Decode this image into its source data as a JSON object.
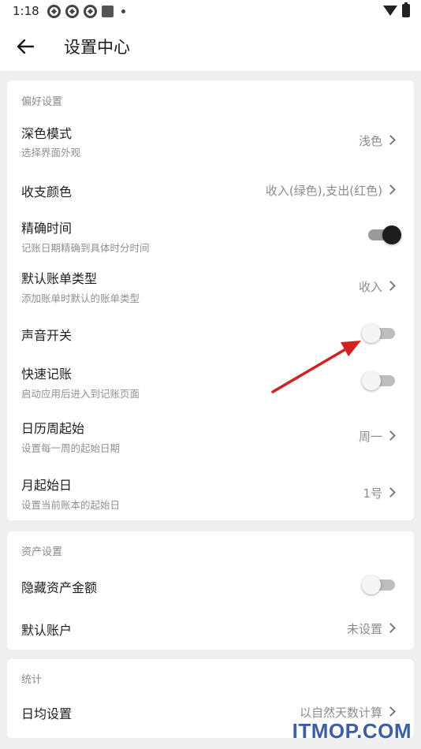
{
  "status_bar": {
    "time": "1:18"
  },
  "header": {
    "title": "设置中心",
    "back_icon": "arrow-left-icon"
  },
  "preferences": {
    "title": "偏好设置",
    "dark_mode": {
      "label": "深色模式",
      "sub": "选择界面外观",
      "value": "浅色"
    },
    "income_expense_color": {
      "label": "收支颜色",
      "value": "收入(绿色),支出(红色)"
    },
    "precise_time": {
      "label": "精确时间",
      "sub": "记账日期精确到具体时分时间",
      "enabled": true
    },
    "default_bill_type": {
      "label": "默认账单类型",
      "sub": "添加账单时默认的账单类型",
      "value": "收入"
    },
    "sound": {
      "label": "声音开关",
      "enabled": false
    },
    "quick_entry": {
      "label": "快速记账",
      "sub": "启动应用后进入到记账页面",
      "enabled": false
    },
    "week_start": {
      "label": "日历周起始",
      "sub": "设置每一周的起始日期",
      "value": "周一"
    },
    "month_start": {
      "label": "月起始日",
      "sub": "设置当前账本的起始日",
      "value": "1号"
    }
  },
  "assets": {
    "title": "资产设置",
    "hide_amount": {
      "label": "隐藏资产金额",
      "enabled": false
    },
    "default_account": {
      "label": "默认账户",
      "value": "未设置"
    }
  },
  "stats": {
    "title": "统计",
    "daily_average": {
      "label": "日均设置",
      "value": "以自然天数计算"
    }
  },
  "annotation": {
    "color": "#d42020"
  },
  "watermark": {
    "text": "ITMOP.COM"
  }
}
